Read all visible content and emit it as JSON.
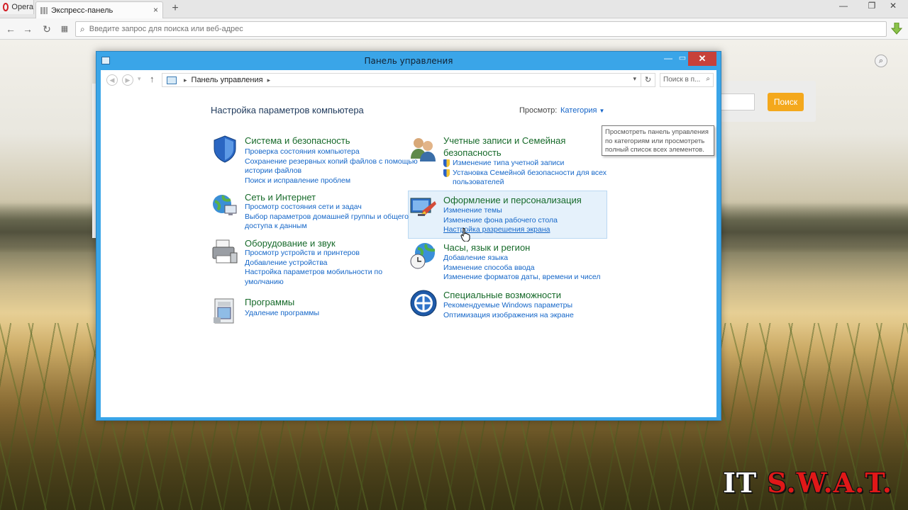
{
  "browser": {
    "menu_label": "Opera",
    "tab_title": "Экспресс-панель",
    "new_tab_symbol": "+",
    "address_placeholder": "Введите запрос для поиска или веб-адрес",
    "speed_dial_search_button": "Поиск"
  },
  "window": {
    "title": "Панель управления",
    "breadcrumb": "Панель управления",
    "search_placeholder": "Поиск в п...",
    "heading": "Настройка параметров компьютера",
    "view_label": "Просмотр:",
    "view_value": "Категория",
    "tooltip": "Просмотреть панель управления по категориям или просмотреть полный список всех элементов."
  },
  "categories_left": [
    {
      "icon": "security-shield-icon",
      "title": "Система и безопасность",
      "links": [
        "Проверка состояния компьютера",
        "Сохранение резервных копий файлов с помощью истории файлов",
        "Поиск и исправление проблем"
      ]
    },
    {
      "icon": "network-globe-icon",
      "title": "Сеть и Интернет",
      "links": [
        "Просмотр состояния сети и задач",
        "Выбор параметров домашней группы и общего доступа к данным"
      ]
    },
    {
      "icon": "printer-hardware-icon",
      "title": "Оборудование и звук",
      "links": [
        "Просмотр устройств и принтеров",
        "Добавление устройства",
        "Настройка параметров мобильности по умолчанию"
      ]
    },
    {
      "icon": "programs-icon",
      "title": "Программы",
      "links": [
        "Удаление программы"
      ]
    }
  ],
  "categories_right": [
    {
      "icon": "user-accounts-icon",
      "title": "Учетные записи и Семейная безопасность",
      "links": [
        "Изменение типа учетной записи",
        "Установка Семейной безопасности для всех пользователей"
      ]
    },
    {
      "icon": "appearance-icon",
      "title": "Оформление и персонализация",
      "links": [
        "Изменение темы",
        "Изменение фона рабочего стола",
        "Настройка разрешения экрана"
      ]
    },
    {
      "icon": "clock-globe-icon",
      "title": "Часы, язык и регион",
      "links": [
        "Добавление языка",
        "Изменение способа ввода",
        "Изменение форматов даты, времени и чисел"
      ]
    },
    {
      "icon": "ease-of-access-icon",
      "title": "Специальные возможности",
      "links": [
        "Рекомендуемые Windows параметры",
        "Оптимизация изображения на экране"
      ]
    }
  ],
  "watermark": {
    "part1": "IT ",
    "part2": "S.W.A.T."
  },
  "colors": {
    "titlebar": "#3aa5e8",
    "category_title": "#176a2a",
    "link": "#1466c8",
    "search_button": "#f4a81c",
    "close": "#c7413a"
  }
}
